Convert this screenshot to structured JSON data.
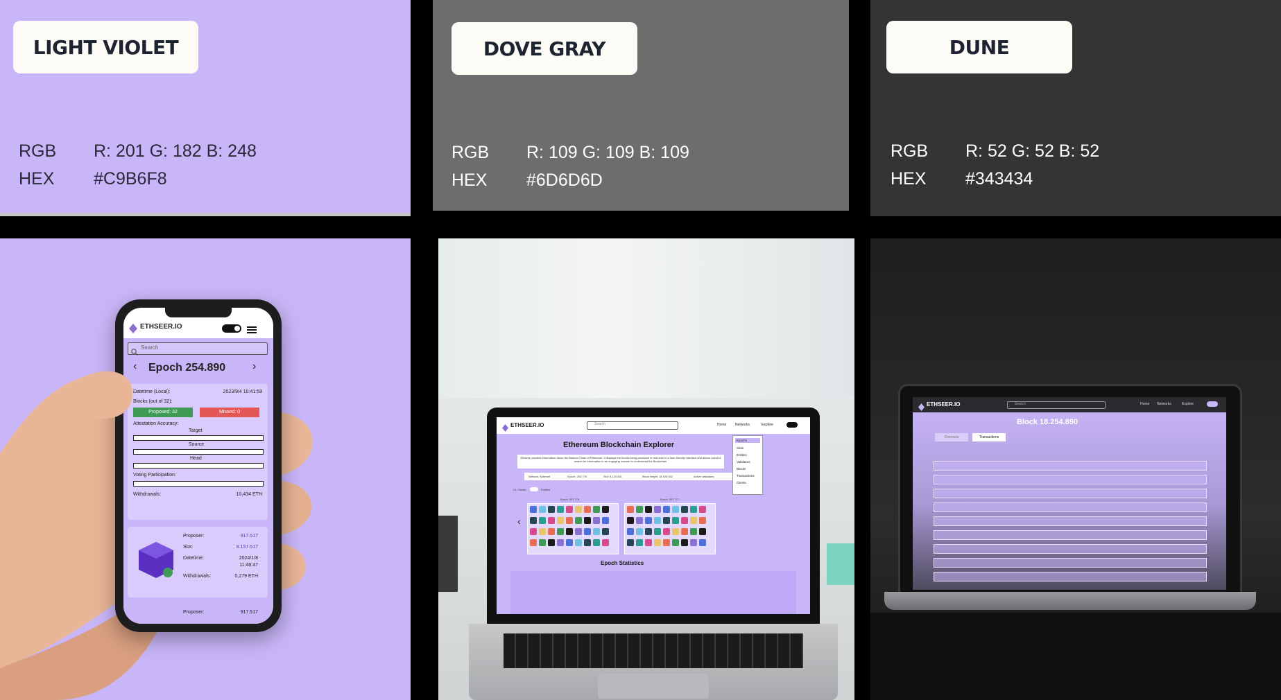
{
  "swatches": [
    {
      "name": "LIGHT VIOLET",
      "rgb_label": "RGB",
      "rgb": "R: 201  G: 182  B: 248",
      "hex_label": "HEX",
      "hex": "#C9B6F8",
      "color": "#C9B6F8",
      "text_color": "#2a2a3a"
    },
    {
      "name": "DOVE GRAY",
      "rgb_label": "RGB",
      "rgb": "R: 109  G: 109  B: 109",
      "hex_label": "HEX",
      "hex": "#6D6D6D",
      "color": "#6D6D6D",
      "text_color": "#ffffff"
    },
    {
      "name": "DUNE",
      "rgb_label": "RGB",
      "rgb": "R: 52 G: 52  B: 52",
      "hex_label": "HEX",
      "hex": "#343434",
      "color": "#343434",
      "text_color": "#ffffff"
    }
  ],
  "phone": {
    "brand": "ETHSEER.IO",
    "search_placeholder": "Search",
    "epoch_title": "Epoch 254.890",
    "datetime_label": "Datetime (Local):",
    "datetime_value": "2023/9/4   10:41:59",
    "blocks_label": "Blocks (out of 32):",
    "proposed": "Proposed: 32",
    "missed": "Missed: 0",
    "attestation_label": "Attestation Accuracy:",
    "target_label": "Target",
    "source_label": "Source",
    "head_label": "Head",
    "voting_label": "Voting Participation:",
    "withdrawals_label": "Withdrawals:",
    "withdrawals_value": "10,434 ETH",
    "proposer_label": "Proposer:",
    "proposer_value": "917.517",
    "slot_label": "Slot:",
    "slot_value": "8.157.517",
    "block_datetime_label": "Datetime:",
    "block_datetime_value": "2024/1/8",
    "block_time_value": "11:48:47",
    "block_withdrawals_label": "Withdrawals:",
    "block_withdrawals_value": "0,279 ETH",
    "next_proposer_label": "Proposer:",
    "next_proposer_value": "917.517",
    "accent": "#C9B6F8",
    "proposed_color": "#3f9a55",
    "missed_color": "#e45757"
  },
  "laptop1": {
    "brand": "ETHSEER.IO",
    "search_placeholder": "Search",
    "nav": [
      "Home",
      "Networks",
      "Explore"
    ],
    "dropdown": [
      "Epochs",
      "Slots",
      "Entities",
      "Validators",
      "Blocks",
      "Transactions",
      "Clients"
    ],
    "title": "Ethereum Blockchain Explorer",
    "description": "Ethseer provides information about the Beacon Chain of Ethereum. It displays the blocks being produced in real-time in a user-friendly interface and allows users to search for information in an engaging manner to understand the Blockchain.",
    "stats": [
      "Network: Mainnet",
      "Epoch: 253.776",
      "Slot: 8.120.831",
      "Block height: 18.928.922",
      "Active Validators"
    ],
    "cl_clients": "CL Clients",
    "entities": "Entities",
    "epoch_a": "Epoch 253.776",
    "epoch_b": "Epoch 253.777",
    "section_title": "Epoch Statistics"
  },
  "laptop2": {
    "brand": "ETHSEER.IO",
    "search_placeholder": "Search",
    "nav": [
      "Home",
      "Networks",
      "Explore"
    ],
    "title": "Block 18.254.890",
    "tabs": [
      "Overview",
      "Transactions"
    ]
  }
}
